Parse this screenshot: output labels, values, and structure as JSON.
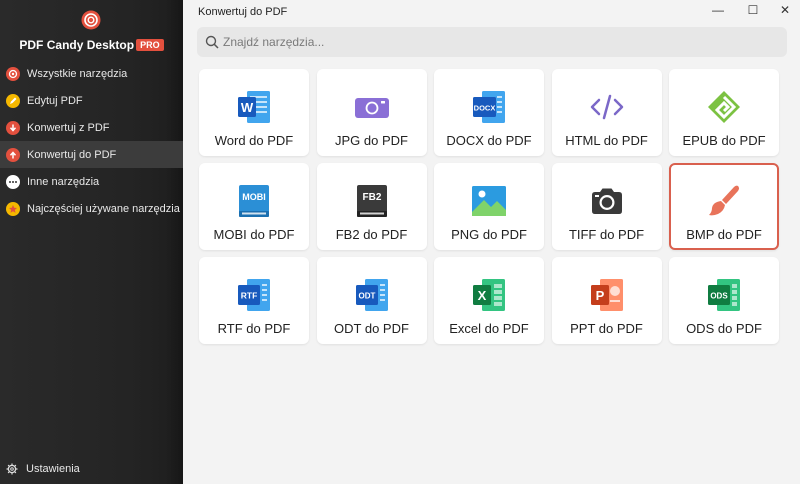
{
  "sidebar": {
    "brand": "PDF Candy Desktop",
    "badge": "PRO",
    "items": [
      {
        "label": "Wszystkie narzędzia",
        "icon": "target-icon",
        "color": "#e3503e",
        "active": false
      },
      {
        "label": "Edytuj PDF",
        "icon": "pencil-icon",
        "color": "#f5b800",
        "active": false
      },
      {
        "label": "Konwertuj z PDF",
        "icon": "arrow-down-icon",
        "color": "#e3503e",
        "active": false
      },
      {
        "label": "Konwertuj do PDF",
        "icon": "arrow-up-icon",
        "color": "#e3503e",
        "active": true
      },
      {
        "label": "Inne narzędzia",
        "icon": "more-icon",
        "color": "#ffffff",
        "active": false
      },
      {
        "label": "Najczęściej używane narzędzia",
        "icon": "star-icon",
        "color": "#f5b800",
        "active": false
      }
    ],
    "settings_label": "Ustawienia"
  },
  "window": {
    "title": "Konwertuj do PDF",
    "minimize": "—",
    "maximize": "☐",
    "close": "✕"
  },
  "search": {
    "placeholder": "Znajdź narzędzia..."
  },
  "tools": [
    {
      "label": "Word do PDF",
      "icon": "word-icon",
      "text": "W",
      "color": "#2b7cd3"
    },
    {
      "label": "JPG do PDF",
      "icon": "jpg-icon",
      "text": "",
      "color": "#8a6fd6"
    },
    {
      "label": "DOCX do PDF",
      "icon": "docx-icon",
      "text": "DOCX",
      "color": "#2b7cd3"
    },
    {
      "label": "HTML do PDF",
      "icon": "html-icon",
      "text": "</>",
      "color": "#7b68c8"
    },
    {
      "label": "EPUB do PDF",
      "icon": "epub-icon",
      "text": "",
      "color": "#7cc242"
    },
    {
      "label": "MOBI do PDF",
      "icon": "mobi-icon",
      "text": "MOBI",
      "color": "#2b8fd6"
    },
    {
      "label": "FB2 do PDF",
      "icon": "fb2-icon",
      "text": "FB2",
      "color": "#3a3a3a"
    },
    {
      "label": "PNG do PDF",
      "icon": "png-icon",
      "text": "",
      "color": "#2b9be0"
    },
    {
      "label": "TIFF do PDF",
      "icon": "camera-icon",
      "text": "",
      "color": "#3a3a3a"
    },
    {
      "label": "BMP do PDF",
      "icon": "brush-icon",
      "text": "",
      "color": "#e8735a",
      "selected": true
    },
    {
      "label": "RTF do PDF",
      "icon": "rtf-icon",
      "text": "RTF",
      "color": "#2b7cd3"
    },
    {
      "label": "ODT do PDF",
      "icon": "odt-icon",
      "text": "ODT",
      "color": "#2b7cd3"
    },
    {
      "label": "Excel do PDF",
      "icon": "excel-icon",
      "text": "X",
      "color": "#21a366"
    },
    {
      "label": "PPT do PDF",
      "icon": "ppt-icon",
      "text": "P",
      "color": "#d9534f"
    },
    {
      "label": "ODS do PDF",
      "icon": "ods-icon",
      "text": "ODS",
      "color": "#21a366"
    }
  ]
}
